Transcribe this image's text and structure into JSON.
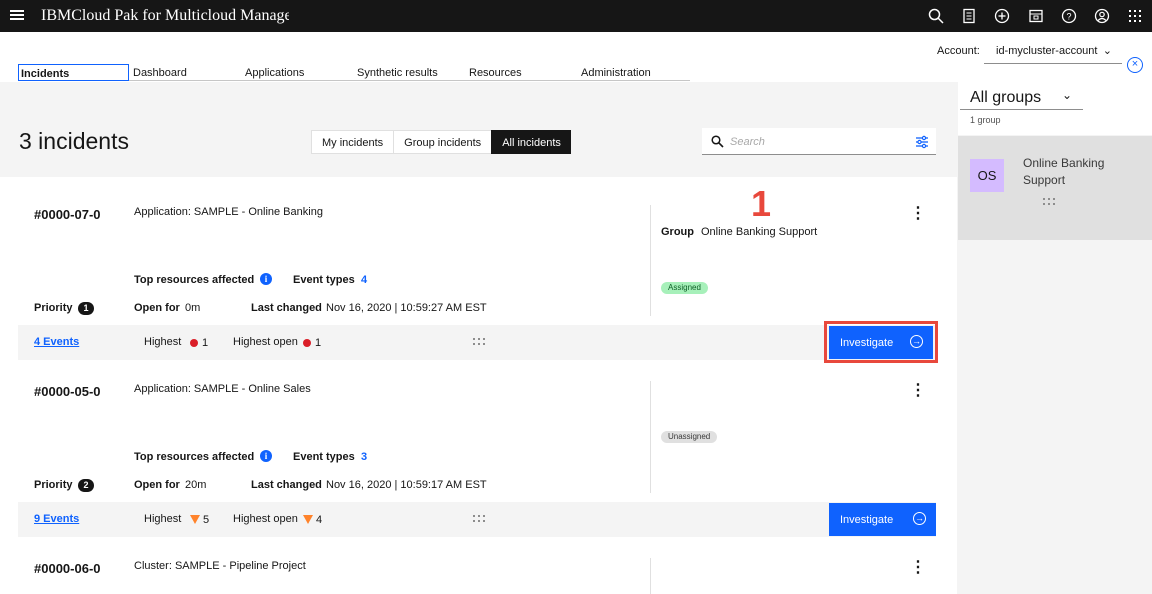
{
  "header": {
    "title": "IBMCloud Pak for Multicloud Managem"
  },
  "account": {
    "label": "Account:",
    "value": "id-mycluster-account"
  },
  "nav": {
    "tabs": [
      "Incidents",
      "Dashboard",
      "Applications",
      "Synthetic results",
      "Resources",
      "Administration"
    ]
  },
  "main": {
    "count": "3 incidents",
    "filters": [
      "My incidents",
      "Group incidents",
      "All incidents"
    ],
    "search_placeholder": "Search"
  },
  "incidents": [
    {
      "id": "#0000-07-0",
      "app": "Application: SAMPLE - Online Banking",
      "top_label": "Top resources affected",
      "event_types_label": "Event types",
      "event_types": "4",
      "priority_label": "Priority",
      "priority": "1",
      "open_for_label": "Open for",
      "open_for": "0m",
      "last_changed_label": "Last changed",
      "last_changed": "Nov 16, 2020 | 10:59:27 AM EST",
      "group_label": "Group",
      "group": "Online Banking Support",
      "status": "Assigned",
      "events_link": "4 Events",
      "highest_label": "Highest",
      "highest": "1",
      "highest_open_label": "Highest open",
      "highest_open": "1",
      "button": "Investigate"
    },
    {
      "id": "#0000-05-0",
      "app": "Application: SAMPLE - Online Sales",
      "top_label": "Top resources affected",
      "event_types_label": "Event types",
      "event_types": "3",
      "priority_label": "Priority",
      "priority": "2",
      "open_for_label": "Open for",
      "open_for": "20m",
      "last_changed_label": "Last changed",
      "last_changed": "Nov 16, 2020 | 10:59:17 AM EST",
      "status": "Unassigned",
      "events_link": "9 Events",
      "highest_label": "Highest",
      "highest": "5",
      "highest_open_label": "Highest open",
      "highest_open": "4",
      "button": "Investigate"
    },
    {
      "id": "#0000-06-0",
      "app": "Cluster: SAMPLE - Pipeline Project"
    }
  ],
  "annotation": {
    "number": "1",
    "color": "#e8483c"
  },
  "sidebar": {
    "groups_title": "All groups",
    "groups_count": "1 group",
    "card_initials": "OS",
    "card_name": "Online Banking Support"
  },
  "colors": {
    "accent": "#0f62fe",
    "topbar": "#161616",
    "annotation": "#e8483c",
    "assigned_bg": "#a7f0ba",
    "unassigned_bg": "#e0e0e0"
  }
}
